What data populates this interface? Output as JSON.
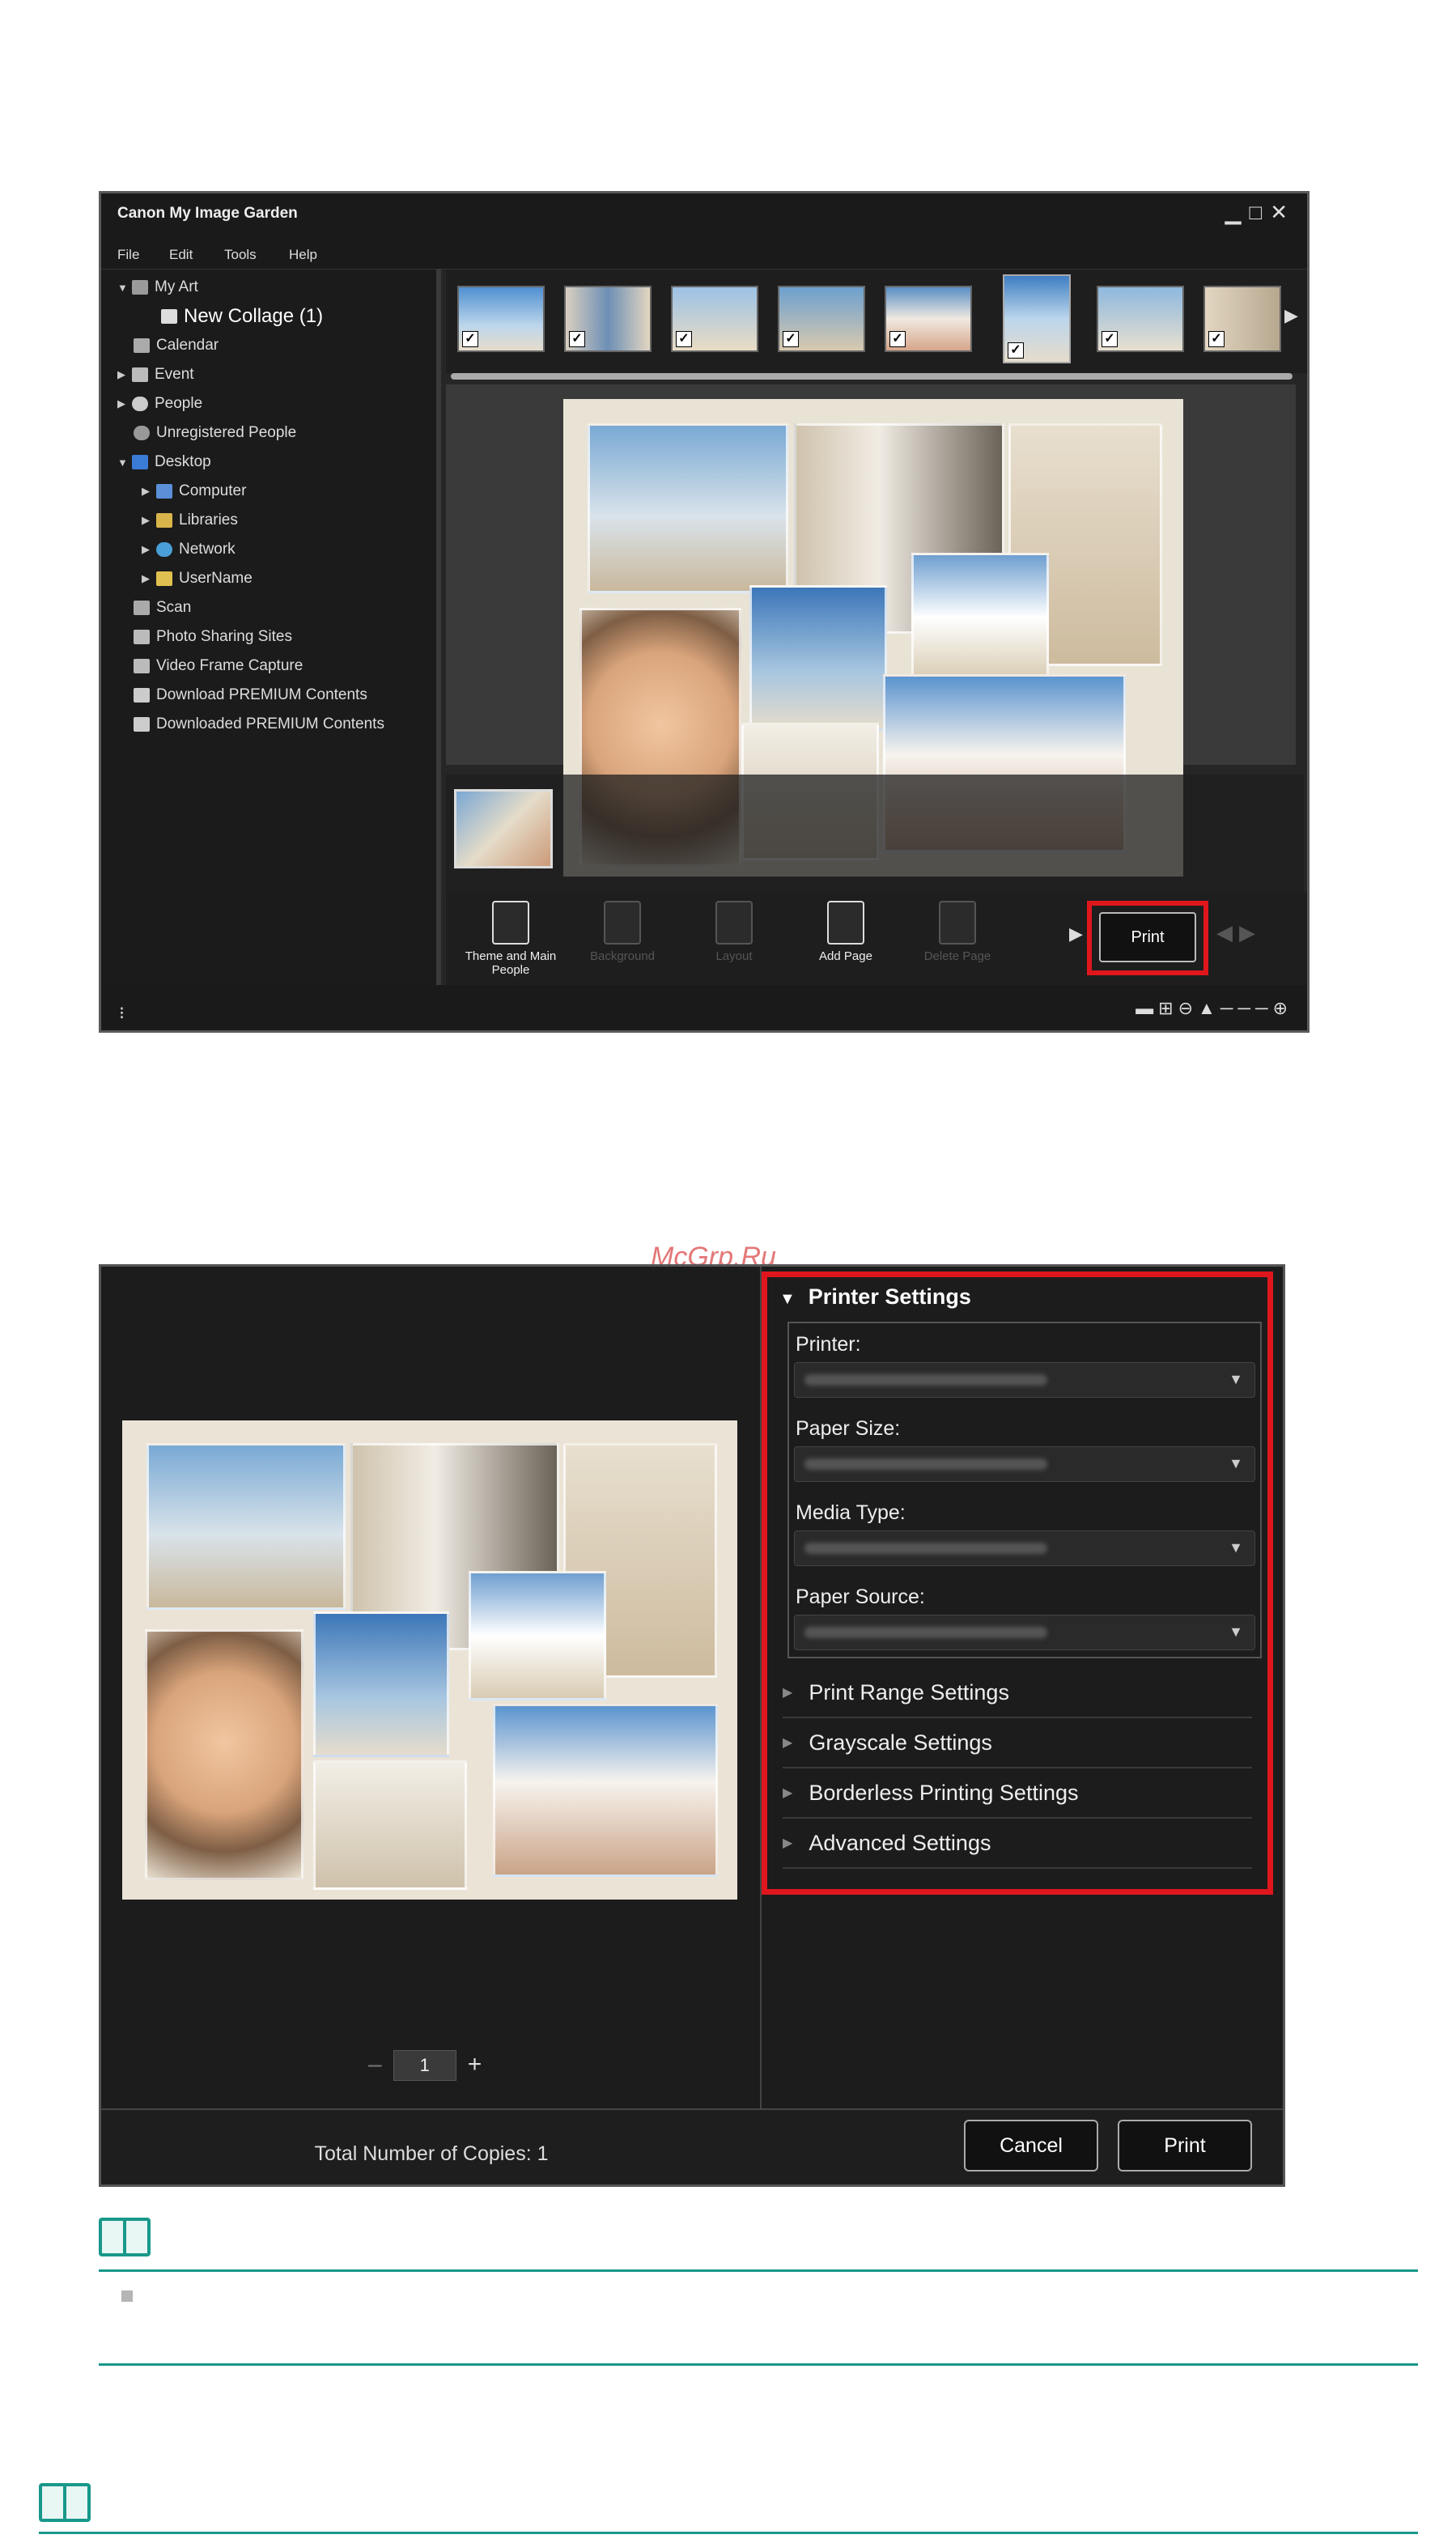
{
  "app": {
    "title": "Canon My Image Garden",
    "window_controls": [
      "minimize-icon",
      "maximize-icon",
      "close-icon"
    ],
    "menu": [
      "File",
      "Edit",
      "Tools",
      "Help"
    ]
  },
  "tree": [
    {
      "label": "My Art",
      "icon": "my-art-icon"
    },
    {
      "label": "New Collage (1)",
      "icon": "collage-icon"
    },
    {
      "label": "Calendar",
      "icon": "calendar-icon"
    },
    {
      "label": "Event",
      "icon": "event-icon"
    },
    {
      "label": "People",
      "icon": "person-icon"
    },
    {
      "label": "Unregistered People",
      "icon": "unregistered-person-icon"
    },
    {
      "label": "Desktop",
      "icon": "desktop-icon"
    },
    {
      "label": "Computer",
      "icon": "computer-icon"
    },
    {
      "label": "Libraries",
      "icon": "libraries-icon"
    },
    {
      "label": "Network",
      "icon": "network-icon"
    },
    {
      "label": "UserName",
      "icon": "user-folder-icon"
    },
    {
      "label": "Scan",
      "icon": "scan-icon"
    },
    {
      "label": "Photo Sharing Sites",
      "icon": "photo-sharing-icon"
    },
    {
      "label": "Video Frame Capture",
      "icon": "video-frame-icon"
    },
    {
      "label": "Download PREMIUM Contents",
      "icon": "download-icon"
    },
    {
      "label": "Downloaded PREMIUM Contents",
      "icon": "folder-icon"
    }
  ],
  "toolbar": {
    "theme": "Theme and Main People",
    "background": "Background",
    "layout": "Layout",
    "add_page": "Add Page",
    "delete_page": "Delete Page",
    "print": "Print"
  },
  "print_dialog": {
    "printer_settings": "Printer Settings",
    "printer_label": "Printer:",
    "paper_size_label": "Paper Size:",
    "media_type_label": "Media Type:",
    "paper_source_label": "Paper Source:",
    "sections": [
      "Print Range Settings",
      "Grayscale Settings",
      "Borderless Printing Settings",
      "Advanced Settings"
    ],
    "copies_minus": "–",
    "copies_value": "1",
    "copies_plus": "+",
    "total_copies": "Total Number of Copies: 1",
    "cancel": "Cancel",
    "print": "Print"
  },
  "watermark": "McGrp.Ru",
  "colors": {
    "highlight": "#e0161d",
    "note_accent": "#18988a"
  }
}
